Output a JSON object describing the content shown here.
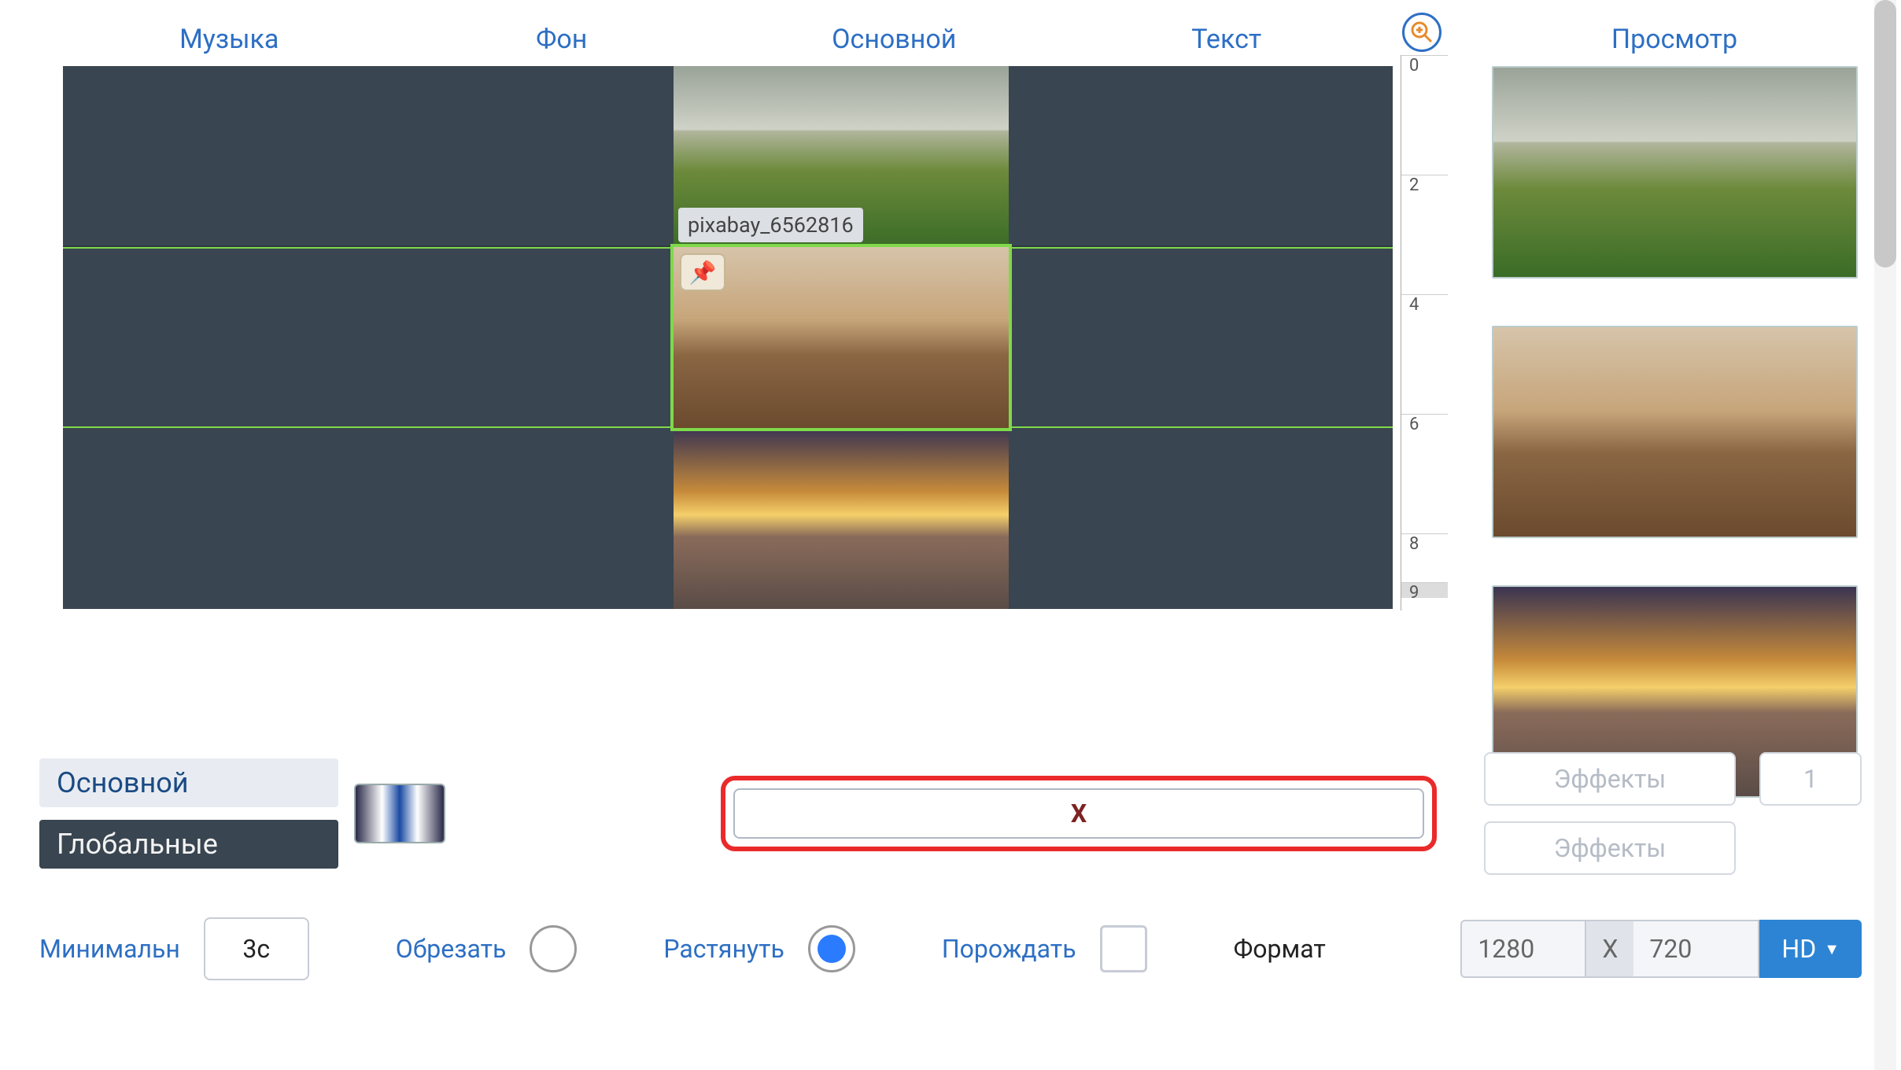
{
  "tabs": {
    "music": "Музыка",
    "bg": "Фон",
    "main": "Основной",
    "text": "Текст",
    "preview": "Просмотр"
  },
  "clip_label": "pixabay_6562816",
  "ruler": [
    "0",
    "2",
    "4",
    "6",
    "8",
    "9"
  ],
  "bottom_tabs": {
    "main": "Основной",
    "global": "Глобальные"
  },
  "x_label": "X",
  "effects_label": "Эффекты",
  "effects_count": "1",
  "opts": {
    "min": "Минимальн",
    "min_val": "3с",
    "crop": "Обрезать",
    "stretch": "Растянуть",
    "spawn": "Порождать",
    "format": "Формат"
  },
  "format": {
    "w": "1280",
    "sep": "X",
    "h": "720",
    "preset": "HD"
  }
}
